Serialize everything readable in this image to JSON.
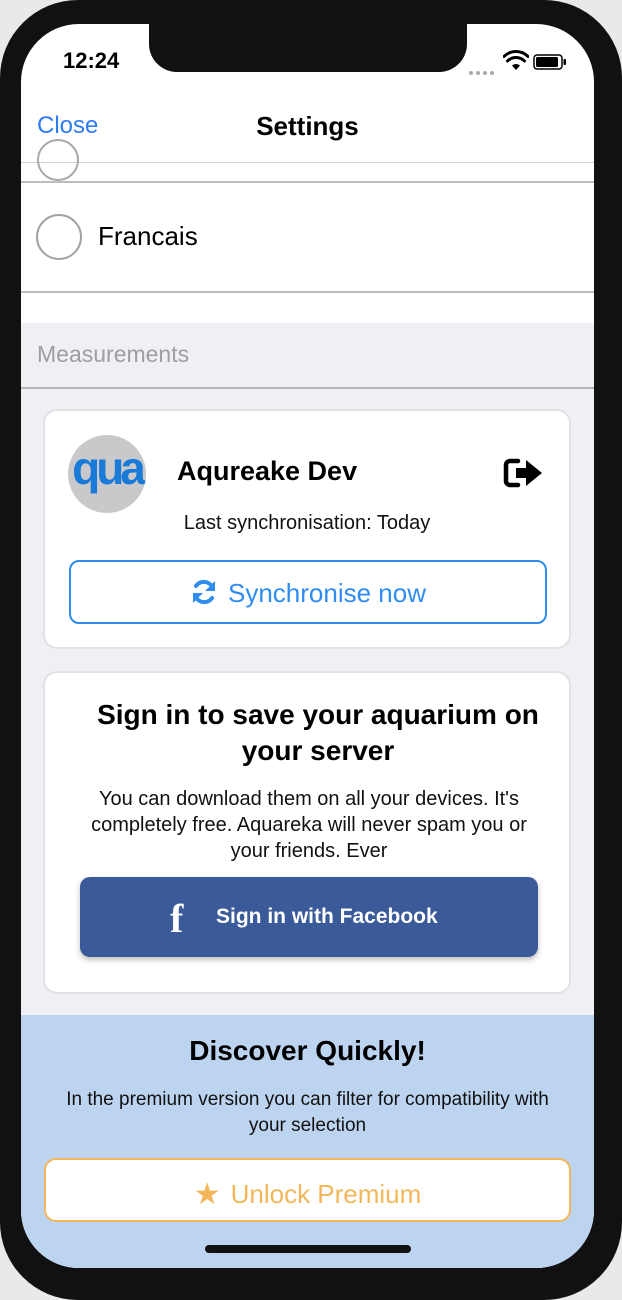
{
  "status_bar": {
    "time": "12:24"
  },
  "nav": {
    "close_label": "Close",
    "title": "Settings"
  },
  "languages": [
    {
      "label": "Francais",
      "selected": false
    }
  ],
  "section": {
    "measurements_label": "Measurements"
  },
  "account": {
    "avatar_text": "qua",
    "name": "Aqureake Dev",
    "last_sync": "Last synchronisation: Today",
    "sync_button": "Synchronise now"
  },
  "signin": {
    "title": "Sign in to save your aquarium on your server",
    "text": "You can download them on all your devices. It's completely free. Aquareka will never spam you or your friends. Ever",
    "facebook_button": "Sign in with Facebook"
  },
  "promo": {
    "title": "Discover Quickly!",
    "text": "In the premium version you can filter for compatibility with your selection",
    "button": "Unlock Premium"
  },
  "colors": {
    "accent": "#2f8cf0",
    "facebook": "#3b5a9a",
    "premium": "#f3b75a",
    "promo_bg": "#bdd4f1"
  },
  "icons": [
    "wifi-icon",
    "battery-icon",
    "logout-icon",
    "refresh-icon",
    "facebook-icon",
    "star-icon"
  ]
}
